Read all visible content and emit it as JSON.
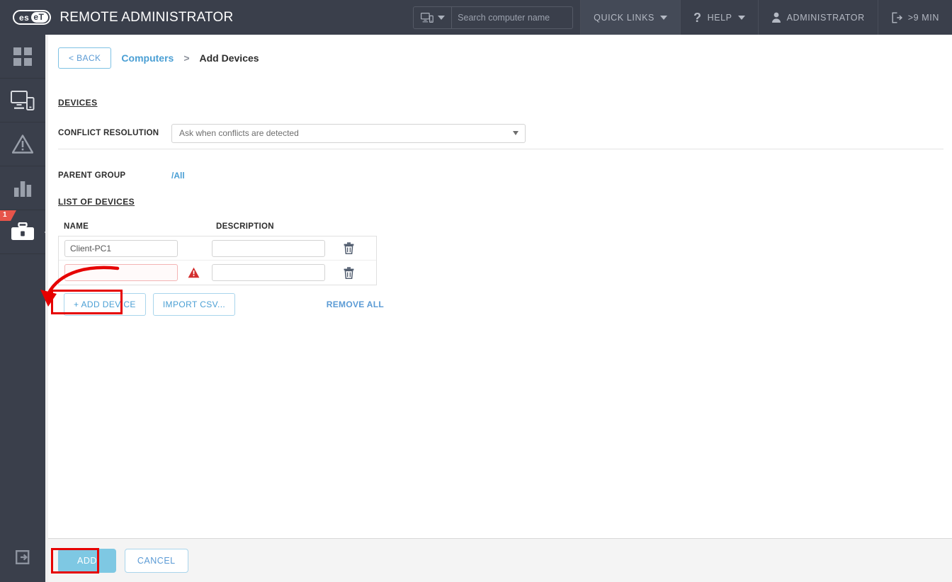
{
  "header": {
    "logo_text_a": "es",
    "logo_text_b": "eT",
    "product_title": "REMOTE ADMINISTRATOR",
    "search_placeholder": "Search computer name",
    "search_value": "",
    "nav": {
      "quick_links": "QUICK LINKS",
      "help": "HELP",
      "administrator": "ADMINISTRATOR",
      "session": ">9 MIN"
    }
  },
  "sidebar": {
    "items": [
      {
        "name": "dashboard",
        "icon": "grid-icon",
        "badge": ""
      },
      {
        "name": "computers",
        "icon": "monitor-mobile-icon",
        "badge": ""
      },
      {
        "name": "threats",
        "icon": "warning-triangle-icon",
        "badge": ""
      },
      {
        "name": "reports",
        "icon": "bar-chart-icon",
        "badge": ""
      },
      {
        "name": "admin",
        "icon": "toolbox-icon",
        "badge": "1"
      }
    ],
    "logout": {
      "name": "logout",
      "icon": "logout-icon"
    }
  },
  "breadcrumb": {
    "back_label": "< BACK",
    "parent": "Computers",
    "separator": ">",
    "current": "Add Devices"
  },
  "form": {
    "devices_heading": "DEVICES",
    "conflict_resolution": {
      "label": "CONFLICT RESOLUTION",
      "value": "Ask when conflicts are detected"
    },
    "parent_group": {
      "label": "PARENT GROUP",
      "value": "/All"
    },
    "list_heading": "LIST OF DEVICES",
    "columns": {
      "name": "NAME",
      "description": "DESCRIPTION"
    },
    "rows": [
      {
        "name": "Client-PC1",
        "description": "",
        "error": false,
        "delete_icon": "trash-icon"
      },
      {
        "name": "",
        "description": "",
        "error": true,
        "error_icon": "warning-triangle-icon",
        "delete_icon": "trash-icon"
      }
    ],
    "add_device_label": "+ ADD DEVICE",
    "import_csv_label": "IMPORT CSV...",
    "remove_all_label": "REMOVE ALL"
  },
  "footer": {
    "add_label": "ADD",
    "cancel_label": "CANCEL"
  },
  "colors": {
    "topbar_bg": "#3a3f4b",
    "accent_blue": "#4a9fd4",
    "primary_btn": "#7ec8e3",
    "error_red": "#e7544a",
    "annotation_red": "#e60000",
    "badge_red": "#e7544a"
  }
}
